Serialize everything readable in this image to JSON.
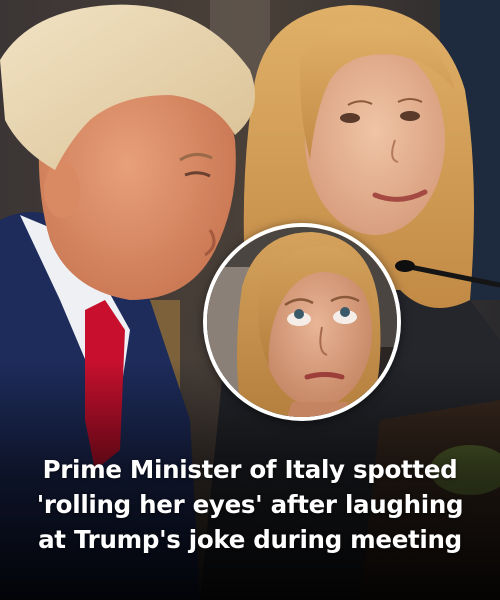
{
  "headline": {
    "lines": [
      "Prime Minister of Italy spotted",
      "'rolling her eyes' after laughing",
      "at Trump's joke during meeting"
    ]
  },
  "image": {
    "scene": "meeting-photo",
    "inset": "close-up-portrait"
  }
}
